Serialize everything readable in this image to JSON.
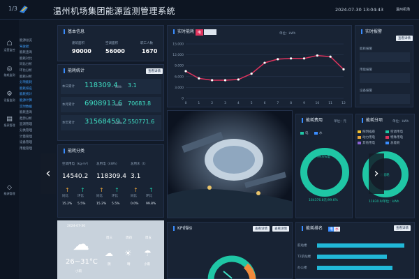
{
  "topbar": {
    "counter": "1/3",
    "title": "温州机场集团能源监测管理系统",
    "datetime": "2024-07-30 13:04:43",
    "user": "温州机场"
  },
  "rail": [
    {
      "icon": "☖",
      "label": "运营监控"
    },
    {
      "icon": "◎",
      "label": "能耗监测"
    },
    {
      "icon": "⚙",
      "label": "设备监测"
    },
    {
      "icon": "▤",
      "label": "报表管理"
    },
    {
      "icon": "◇",
      "label": "能源管理"
    }
  ],
  "submenu": [
    "能源总览",
    "驾驶舱",
    "能耗查询",
    "能耗对比",
    "同比分析",
    "环比分析",
    "能耗分析",
    "分项能耗",
    "能耗排名",
    "能耗统计",
    "能源计算",
    "实时数据",
    "能耗查询",
    "趋势分析",
    "监测管理",
    "分类管理",
    "计量管理",
    "设备管理",
    "用能管理"
  ],
  "basic": {
    "title": "基本信息",
    "items": [
      {
        "label": "建筑面积",
        "value": "90000"
      },
      {
        "label": "空调面积",
        "value": "56000"
      },
      {
        "label": "职工人数",
        "value": "1670"
      }
    ]
  },
  "stats": {
    "title": "能耗统计",
    "btn": "查看详情",
    "rows": [
      {
        "label": "本日累计",
        "value": "118309.4",
        "unit": "kWh",
        "sub": "3.1"
      },
      {
        "label": "本月累计",
        "value": "6908913.6",
        "unit": "kWh",
        "sub": "70683.8"
      },
      {
        "label": "本年累计",
        "value": "31568459.2",
        "unit": "kWh",
        "sub": "550771.6"
      }
    ]
  },
  "category": {
    "title": "能耗分类",
    "cols": [
      {
        "label": "空调用电（kg·m²）",
        "value": "14540.2",
        "up": "同比",
        "up2": "环比",
        "p1": "15.2%",
        "p2": "5.5%"
      },
      {
        "label": "总用电（kWh）",
        "value": "118309.4",
        "up": "同比",
        "up2": "环比",
        "p1": "15.2%",
        "p2": "5.5%"
      },
      {
        "label": "总用水（t）",
        "value": "3.1",
        "up": "同比",
        "up2": "环比",
        "p1": "0.0%",
        "p2": "99.8%"
      }
    ]
  },
  "realtime": {
    "title": "实时能耗",
    "tab": "电",
    "unit": "单位：kWh",
    "yticks": [
      "15,000",
      "12,000",
      "9,000",
      "6,000",
      "3,000",
      "0"
    ],
    "xticks": [
      "0",
      "1",
      "2",
      "3",
      "4",
      "5",
      "6",
      "7",
      "8",
      "9",
      "10",
      "11",
      "12"
    ]
  },
  "alarm": {
    "title": "实时报警",
    "btn": "查看详情",
    "items": [
      "能耗报警",
      "用能报警",
      "设备报警"
    ]
  },
  "cost": {
    "title": "能耗费用",
    "unit": "单位：元",
    "legend": [
      "电",
      "水"
    ],
    "center": "99.6%电",
    "bottom": "164376.8元/99.6%"
  },
  "subitem": {
    "title": "能耗分项",
    "unit": "单位：kWh",
    "legend": [
      "照明插座",
      "空调用电",
      "动力用电",
      "特殊用电",
      "其他用电",
      "总能耗"
    ],
    "center": "总能耗",
    "bottom": "11830.9/单位：kWh"
  },
  "weather": {
    "date": "2024-07-30",
    "temp": "26~31°C",
    "cond": "小雨",
    "days": [
      {
        "d": "周三",
        "w": "阴"
      },
      {
        "d": "周四",
        "w": "晴"
      },
      {
        "d": "周五",
        "w": "小雨"
      }
    ]
  },
  "kpi": {
    "title": "KPI指标",
    "btn1": "查看详情",
    "btn2": "查看详情"
  },
  "ranking": {
    "title": "能耗排名",
    "tabs": [
      "电",
      "水"
    ],
    "btn": "查看详情",
    "rows": [
      {
        "name": "航站楼"
      },
      {
        "name": "T2航站楼"
      },
      {
        "name": "办公楼"
      }
    ]
  },
  "chart_data": [
    {
      "type": "line",
      "title": "实时能耗",
      "ylabel": "单位：kWh",
      "x": [
        0,
        1,
        2,
        3,
        4,
        5,
        6,
        7,
        8,
        9,
        10,
        11,
        12
      ],
      "values": [
        7500,
        5500,
        5000,
        5000,
        5200,
        6800,
        9800,
        10800,
        11000,
        11000,
        11800,
        11500,
        8000
      ],
      "ylim": [
        0,
        15000
      ]
    }
  ],
  "colors": {
    "accent": "#3a8dff",
    "line": "#e0345e",
    "donut": "#1fc6a5",
    "bar": "#22bde0"
  }
}
